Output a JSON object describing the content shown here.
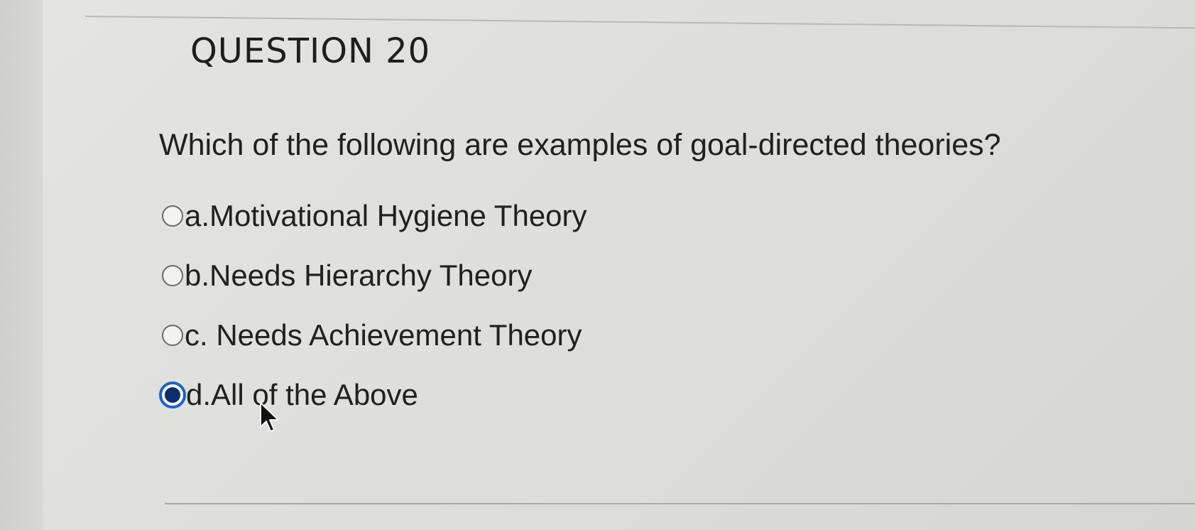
{
  "question": {
    "title": "QUESTION 20",
    "text": "Which of the following are examples of goal-directed theories?",
    "options": [
      {
        "label": "a.Motivational Hygiene Theory",
        "selected": false
      },
      {
        "label": "b.Needs Hierarchy Theory",
        "selected": false
      },
      {
        "label": "c. Needs Achievement Theory",
        "selected": false
      },
      {
        "label": "d.All of the Above",
        "selected": true
      }
    ]
  },
  "colors": {
    "page_background": "#dcdcd8",
    "text": "#202020",
    "radio_selected_ring": "#1c5fd0",
    "radio_selected_dot": "#0c2d6e"
  },
  "icons": {
    "cursor": "mouse-pointer-icon"
  }
}
